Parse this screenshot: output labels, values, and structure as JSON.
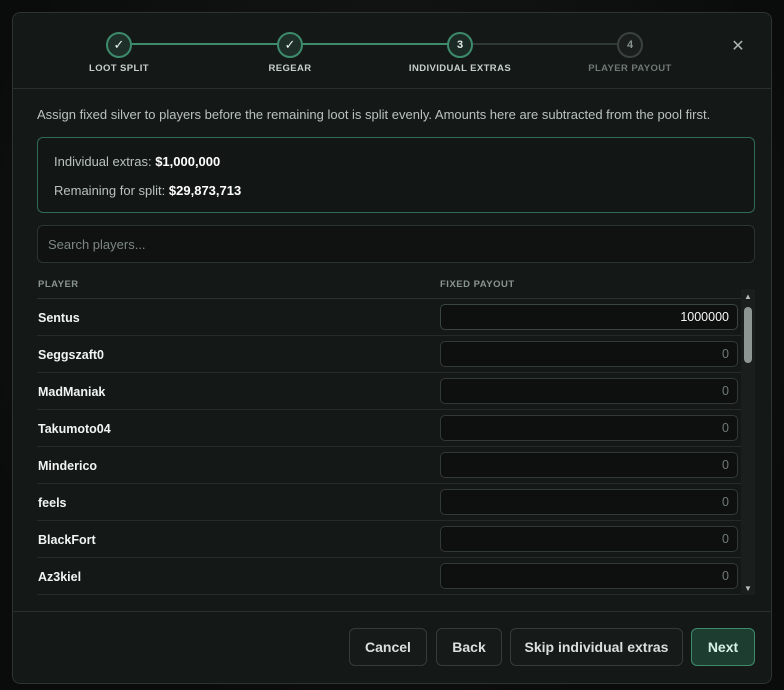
{
  "stepper": {
    "steps": [
      {
        "label": "LOOT SPLIT",
        "state": "done",
        "mark": "✓"
      },
      {
        "label": "REGEAR",
        "state": "done",
        "mark": "✓"
      },
      {
        "label": "INDIVIDUAL EXTRAS",
        "state": "active",
        "mark": "3"
      },
      {
        "label": "PLAYER PAYOUT",
        "state": "todo",
        "mark": "4"
      }
    ],
    "close_glyph": "✕"
  },
  "description": "Assign fixed silver to players before the remaining loot is split evenly. Amounts here are subtracted from the pool first.",
  "summary": {
    "extras_label": "Individual extras:",
    "extras_value": "$1,000,000",
    "remaining_label": "Remaining for split:",
    "remaining_value": "$29,873,713"
  },
  "search": {
    "placeholder": "Search players..."
  },
  "table": {
    "headers": {
      "player": "PLAYER",
      "payout": "FIXED PAYOUT"
    },
    "rows": [
      {
        "player": "Sentus",
        "payout": "1000000"
      },
      {
        "player": "Seggszaft0",
        "payout": "0"
      },
      {
        "player": "MadManiak",
        "payout": "0"
      },
      {
        "player": "Takumoto04",
        "payout": "0"
      },
      {
        "player": "Minderico",
        "payout": "0"
      },
      {
        "player": "feels",
        "payout": "0"
      },
      {
        "player": "BlackFort",
        "payout": "0"
      },
      {
        "player": "Az3kiel",
        "payout": "0"
      }
    ]
  },
  "footer": {
    "cancel": "Cancel",
    "back": "Back",
    "skip": "Skip individual extras",
    "next": "Next"
  },
  "colors": {
    "accent": "#3d8a6c",
    "background": "#141817"
  }
}
